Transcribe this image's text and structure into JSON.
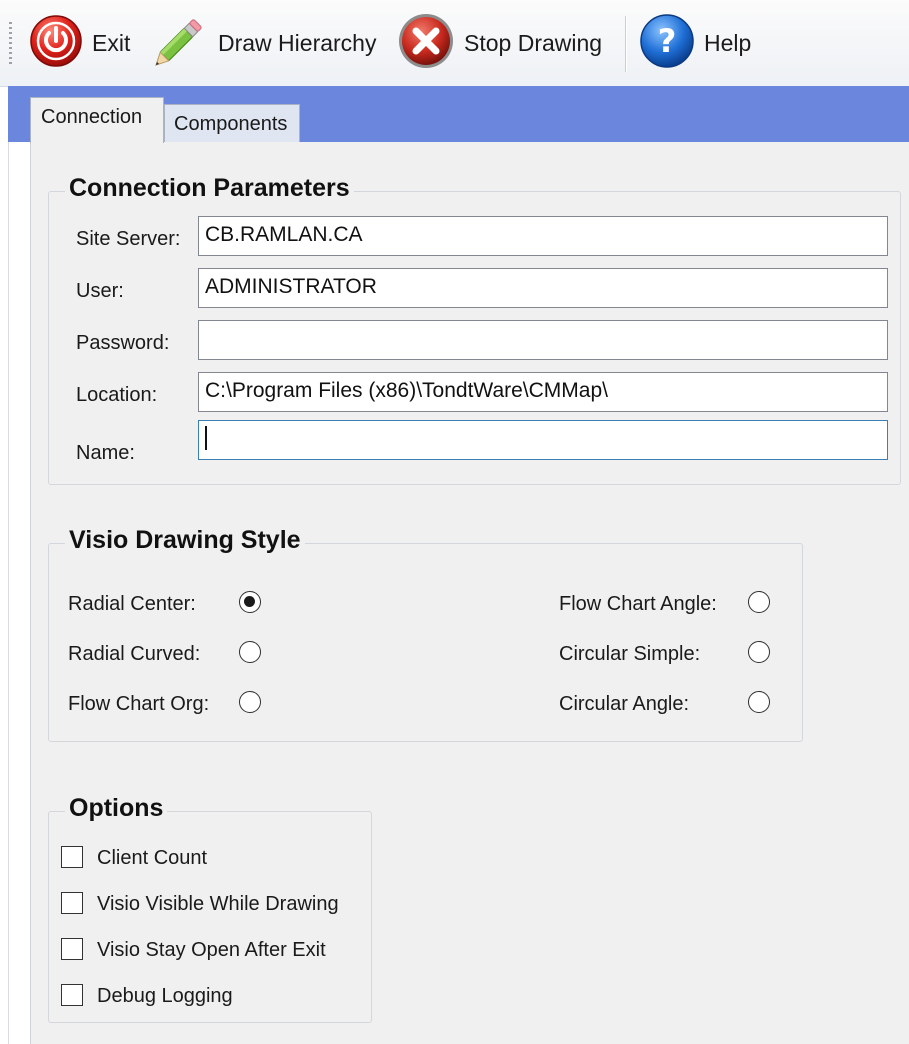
{
  "toolbar": {
    "exit_label": "Exit",
    "draw_label": "Draw Hierarchy",
    "stop_label": "Stop Drawing",
    "help_label": "Help"
  },
  "tabs": {
    "connection": "Connection",
    "components": "Components"
  },
  "connection": {
    "title": "Connection Parameters",
    "site_server_label": "Site Server:",
    "site_server_value": "CB.RAMLAN.CA",
    "user_label": "User:",
    "user_value": "ADMINISTRATOR",
    "password_label": "Password:",
    "password_value": "",
    "location_label": "Location:",
    "location_value": "C:\\Program Files (x86)\\TondtWare\\CMMap\\",
    "name_label": "Name:",
    "name_value": ""
  },
  "style": {
    "title": "Visio Drawing Style",
    "radial_center": "Radial Center:",
    "radial_curved": "Radial Curved:",
    "flow_chart_org": "Flow Chart Org:",
    "flow_chart_angle": "Flow Chart Angle:",
    "circular_simple": "Circular Simple:",
    "circular_angle": "Circular Angle:",
    "selected": "radial_center"
  },
  "options": {
    "title": "Options",
    "client_count": "Client Count",
    "visio_visible": "Visio Visible While Drawing",
    "visio_stay_open": "Visio Stay Open After Exit",
    "debug_logging": "Debug Logging"
  },
  "colors": {
    "band_blue": "#6b86dd",
    "panel_gray": "#f0f0f0",
    "focus_border": "#3c7fb1"
  },
  "icons": {
    "exit": "power-icon",
    "draw": "pencil-icon",
    "stop": "red-x-icon",
    "help": "question-mark-icon"
  }
}
